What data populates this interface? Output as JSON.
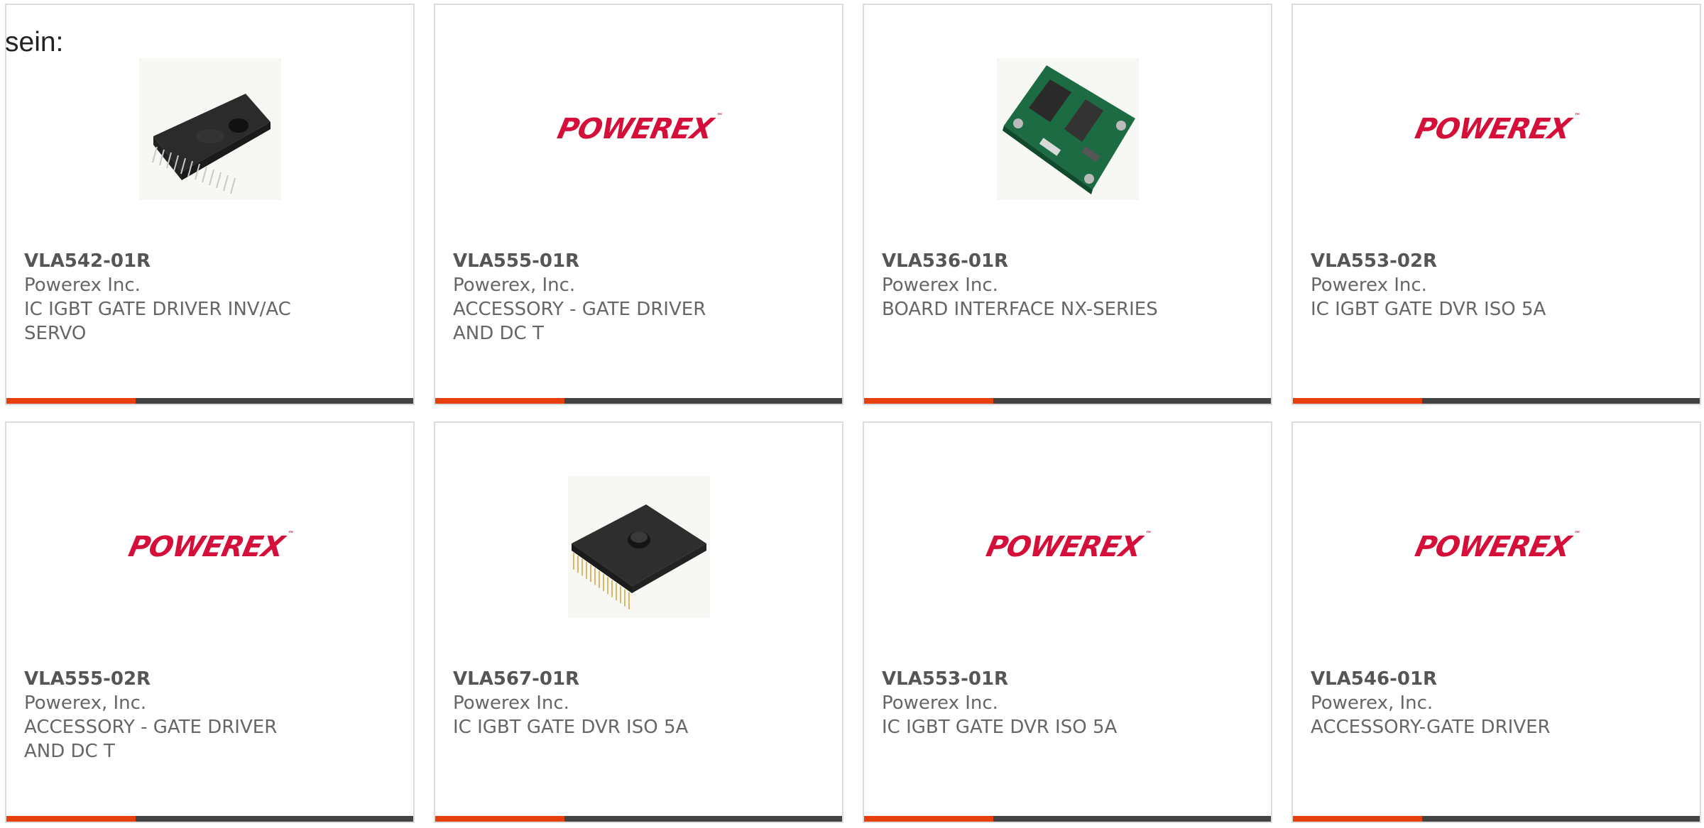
{
  "intro_text": "sein:",
  "brand_logo": "POWEREX",
  "brand_logo_mark": "™",
  "colors": {
    "card_border": "#dcdcdc",
    "accent_orange": "#e8400c",
    "accent_dark": "#444444",
    "logo_red": "#d4103a",
    "text_gray": "#666666"
  },
  "products": [
    {
      "part": "VLA542-01R",
      "manufacturer": "Powerex Inc.",
      "description": "IC IGBT GATE DRIVER INV/AC SERVO",
      "image": "sip-module-photo"
    },
    {
      "part": "VLA555-01R",
      "manufacturer": "Powerex, Inc.",
      "description": "ACCESSORY - GATE DRIVER AND DC T",
      "image": "powerex-logo"
    },
    {
      "part": "VLA536-01R",
      "manufacturer": "Powerex Inc.",
      "description": "BOARD INTERFACE NX-SERIES",
      "image": "pcb-board-photo"
    },
    {
      "part": "VLA553-02R",
      "manufacturer": "Powerex Inc.",
      "description": "IC IGBT GATE DVR ISO 5A",
      "image": "powerex-logo"
    },
    {
      "part": "VLA555-02R",
      "manufacturer": "Powerex, Inc.",
      "description": "ACCESSORY - GATE DRIVER AND DC T",
      "image": "powerex-logo"
    },
    {
      "part": "VLA567-01R",
      "manufacturer": "Powerex Inc.",
      "description": "IC IGBT GATE DVR ISO 5A",
      "image": "flat-module-photo"
    },
    {
      "part": "VLA553-01R",
      "manufacturer": "Powerex Inc.",
      "description": "IC IGBT GATE DVR ISO 5A",
      "image": "powerex-logo"
    },
    {
      "part": "VLA546-01R",
      "manufacturer": "Powerex, Inc.",
      "description": "ACCESSORY-GATE DRIVER",
      "image": "powerex-logo"
    }
  ]
}
